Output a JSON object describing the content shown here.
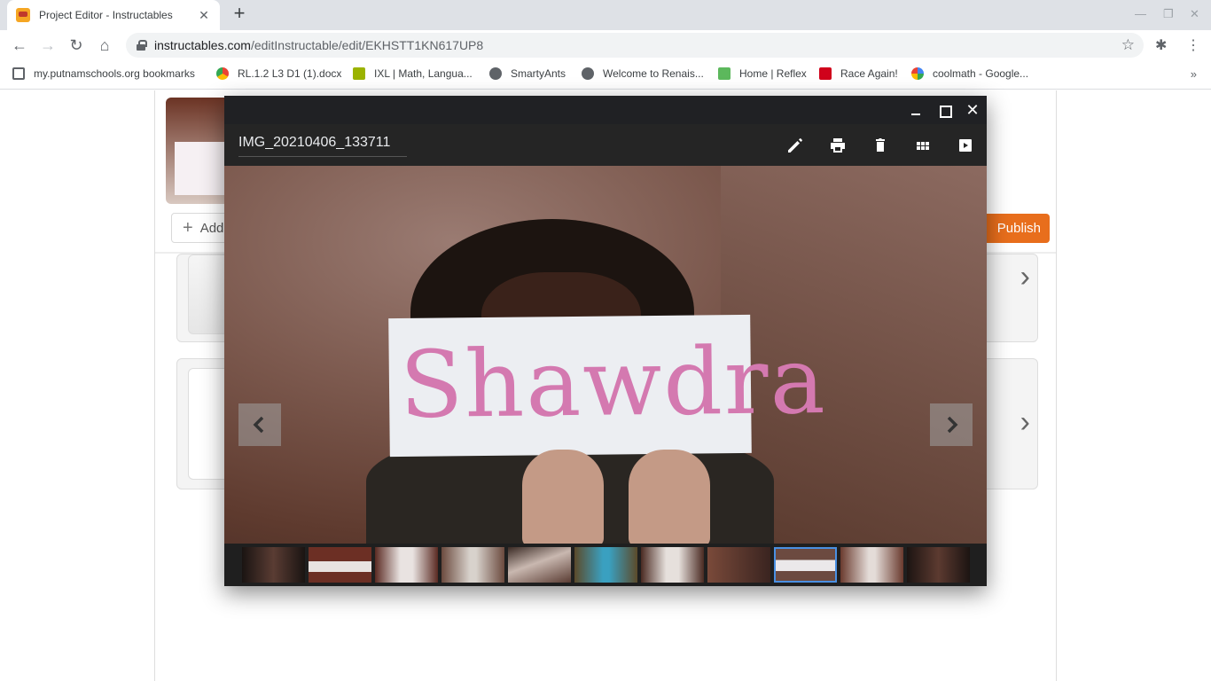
{
  "browser": {
    "tab_title": "Project Editor - Instructables",
    "url_host": "instructables.com",
    "url_path": "/editInstructable/edit/EKHSTT1KN617UP8"
  },
  "bookmarks": [
    {
      "label": "my.putnamschools.org bookmarks",
      "icon": "folder-icon",
      "color": "#5f6368"
    },
    {
      "label": "RL.1.2 L3 D1 (1).docx",
      "icon": "google-drive-icon",
      "color": "#34a853"
    },
    {
      "label": "IXL | Math, Langua...",
      "icon": "ixl-icon",
      "color": "#9bb300"
    },
    {
      "label": "SmartyAnts",
      "icon": "globe-icon",
      "color": "#5f6368"
    },
    {
      "label": "Welcome to Renais...",
      "icon": "globe-icon",
      "color": "#5f6368"
    },
    {
      "label": "Home | Reflex",
      "icon": "reflex-icon",
      "color": "#5cb85c"
    },
    {
      "label": "Race Again!",
      "icon": "race-icon",
      "color": "#d0021b"
    },
    {
      "label": "coolmath - Google...",
      "icon": "google-icon",
      "color": "#4285f4"
    }
  ],
  "editor": {
    "add_label": "Add",
    "publish_label": "Publish",
    "accent_color": "#e86e1c"
  },
  "viewer": {
    "filename": "IMG_20210406_133711",
    "photo_text": "Shawdra",
    "tools": [
      "edit-icon",
      "print-icon",
      "delete-icon",
      "grid-view-icon",
      "slideshow-icon"
    ],
    "filmstrip_count": 11,
    "selected_index": 8,
    "selection_color": "#4a90e2"
  }
}
